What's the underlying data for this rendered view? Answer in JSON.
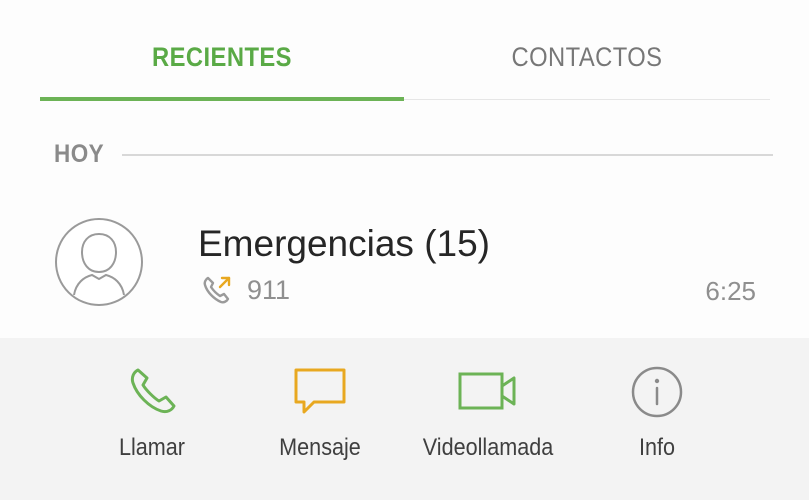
{
  "tabs": {
    "recientes": "RECIENTES",
    "contactos": "CONTACTOS"
  },
  "section": {
    "header": "HOY"
  },
  "log_entry": {
    "name": "Emergencias (15)",
    "number": "911",
    "time": "6:25",
    "call_icon": "outgoing-call-icon",
    "avatar_icon": "person-avatar-icon"
  },
  "actions": {
    "call": {
      "label": "Llamar",
      "icon": "phone-icon",
      "color": "#6cb356"
    },
    "message": {
      "label": "Mensaje",
      "icon": "message-bubble-icon",
      "color": "#e8a820"
    },
    "video": {
      "label": "Videollamada",
      "icon": "video-camera-icon",
      "color": "#6cb356"
    },
    "info": {
      "label": "Info",
      "icon": "info-icon",
      "color": "#8a8a8a"
    }
  },
  "colors": {
    "accent": "#5aaa46",
    "inactive_tab": "#777777",
    "outgoing_arrow": "#e8a820"
  }
}
